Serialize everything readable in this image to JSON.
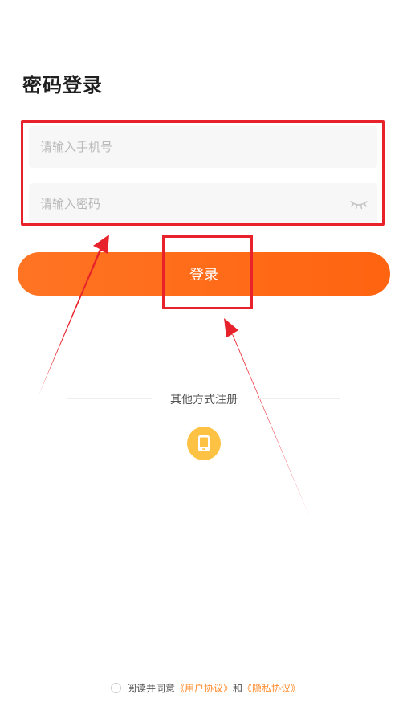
{
  "page": {
    "title": "密码登录"
  },
  "form": {
    "phone_placeholder": "请输入手机号",
    "phone_value": "",
    "password_placeholder": "请输入密码",
    "password_value": "",
    "password_toggle_icon": "eye-closed-icon",
    "login_label": "登录"
  },
  "other_methods": {
    "label": "其他方式注册",
    "icons": [
      "phone-icon"
    ]
  },
  "agreement": {
    "prefix": "阅读并同意",
    "user_agreement": "《用户协议》",
    "conjunction": "和",
    "privacy_policy": "《隐私协议》",
    "checked": false
  },
  "colors": {
    "primary": "#ff6a16",
    "link": "#ff8b2b",
    "phone_icon_bg": "#fdc244",
    "annotation": "#e8222a"
  }
}
